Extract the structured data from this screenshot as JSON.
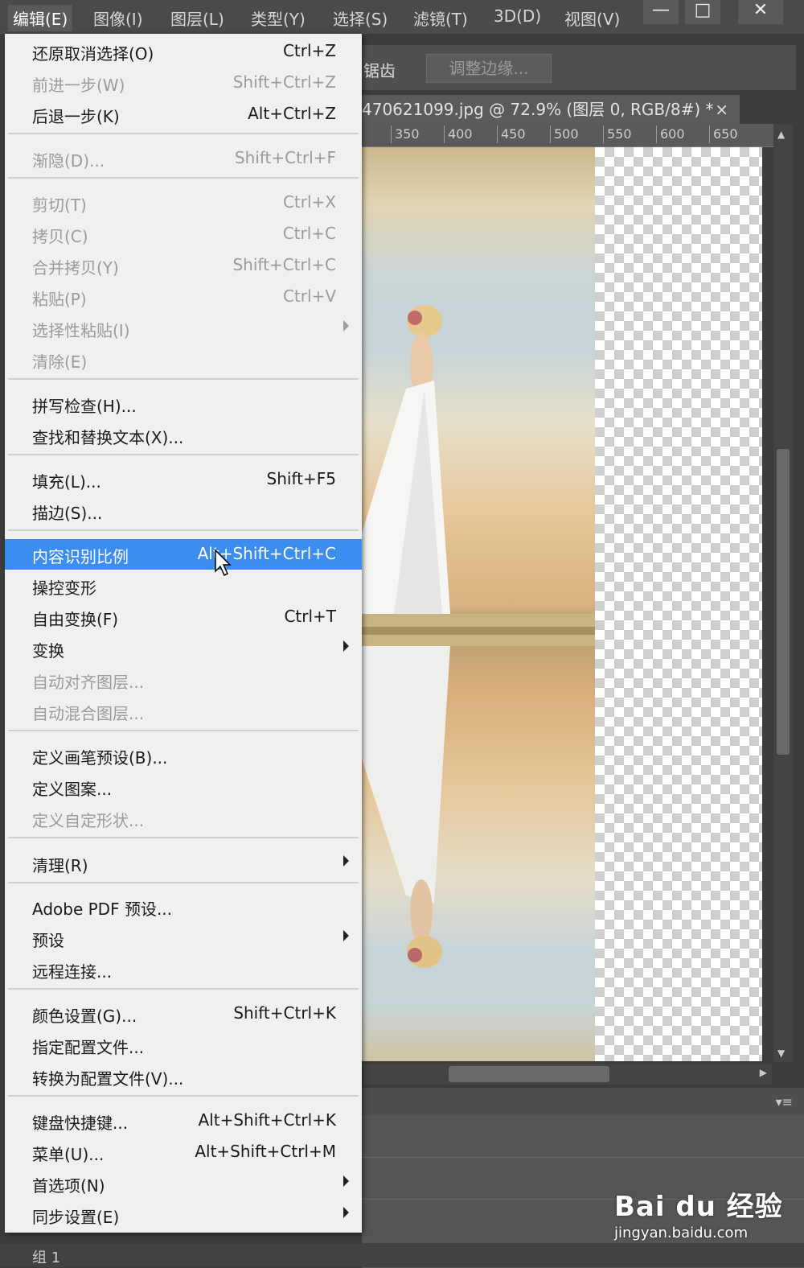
{
  "menubar": {
    "items": [
      "编辑(E)",
      "图像(I)",
      "图层(L)",
      "类型(Y)",
      "选择(S)",
      "滤镜(T)",
      "3D(D)",
      "视图(V)"
    ],
    "active_index": 0
  },
  "window_controls": {
    "minimize": "—",
    "maximize": "□",
    "close": "✕"
  },
  "options_bar": {
    "label": "锯齿",
    "refine_edge_button": "调整边缘..."
  },
  "document_tab": {
    "title": "470621099.jpg @ 72.9% (图层 0, RGB/8#) *",
    "close": "×"
  },
  "ruler": {
    "ticks": [
      "350",
      "400",
      "450",
      "500",
      "550",
      "600",
      "650"
    ]
  },
  "edit_menu": {
    "items": [
      {
        "label": "还原取消选择(O)",
        "shortcut": "Ctrl+Z",
        "enabled": true
      },
      {
        "label": "前进一步(W)",
        "shortcut": "Shift+Ctrl+Z",
        "enabled": false
      },
      {
        "label": "后退一步(K)",
        "shortcut": "Alt+Ctrl+Z",
        "enabled": true
      },
      {
        "label": "渐隐(D)...",
        "shortcut": "Shift+Ctrl+F",
        "enabled": false
      },
      {
        "label": "剪切(T)",
        "shortcut": "Ctrl+X",
        "enabled": false
      },
      {
        "label": "拷贝(C)",
        "shortcut": "Ctrl+C",
        "enabled": false
      },
      {
        "label": "合并拷贝(Y)",
        "shortcut": "Shift+Ctrl+C",
        "enabled": false
      },
      {
        "label": "粘贴(P)",
        "shortcut": "Ctrl+V",
        "enabled": false
      },
      {
        "label": "选择性粘贴(I)",
        "shortcut": "",
        "enabled": false,
        "submenu": true
      },
      {
        "label": "清除(E)",
        "shortcut": "",
        "enabled": false
      },
      {
        "label": "拼写检查(H)...",
        "shortcut": "",
        "enabled": true
      },
      {
        "label": "查找和替换文本(X)...",
        "shortcut": "",
        "enabled": true
      },
      {
        "label": "填充(L)...",
        "shortcut": "Shift+F5",
        "enabled": true
      },
      {
        "label": "描边(S)...",
        "shortcut": "",
        "enabled": true
      },
      {
        "label": "内容识别比例",
        "shortcut": "Alt+Shift+Ctrl+C",
        "enabled": true,
        "highlighted": true
      },
      {
        "label": "操控变形",
        "shortcut": "",
        "enabled": true
      },
      {
        "label": "自由变换(F)",
        "shortcut": "Ctrl+T",
        "enabled": true
      },
      {
        "label": "变换",
        "shortcut": "",
        "enabled": true,
        "submenu": true
      },
      {
        "label": "自动对齐图层...",
        "shortcut": "",
        "enabled": false
      },
      {
        "label": "自动混合图层...",
        "shortcut": "",
        "enabled": false
      },
      {
        "label": "定义画笔预设(B)...",
        "shortcut": "",
        "enabled": true
      },
      {
        "label": "定义图案...",
        "shortcut": "",
        "enabled": true
      },
      {
        "label": "定义自定形状...",
        "shortcut": "",
        "enabled": false
      },
      {
        "label": "清理(R)",
        "shortcut": "",
        "enabled": true,
        "submenu": true
      },
      {
        "label": "Adobe PDF 预设...",
        "shortcut": "",
        "enabled": true
      },
      {
        "label": "预设",
        "shortcut": "",
        "enabled": true,
        "submenu": true
      },
      {
        "label": "远程连接...",
        "shortcut": "",
        "enabled": true
      },
      {
        "label": "颜色设置(G)...",
        "shortcut": "Shift+Ctrl+K",
        "enabled": true
      },
      {
        "label": "指定配置文件...",
        "shortcut": "",
        "enabled": true
      },
      {
        "label": "转换为配置文件(V)...",
        "shortcut": "",
        "enabled": true
      },
      {
        "label": "键盘快捷键...",
        "shortcut": "Alt+Shift+Ctrl+K",
        "enabled": true
      },
      {
        "label": "菜单(U)...",
        "shortcut": "Alt+Shift+Ctrl+M",
        "enabled": true
      },
      {
        "label": "首选项(N)",
        "shortcut": "",
        "enabled": true,
        "submenu": true
      },
      {
        "label": "同步设置(E)",
        "shortcut": "",
        "enabled": true,
        "submenu": true
      }
    ]
  },
  "layers_panel": {
    "group_label": "组 1"
  },
  "watermark": {
    "logo": "Bai du 经验",
    "url": "jingyan.baidu.com"
  },
  "colors": {
    "highlight": "#3b8ef0",
    "menu_bg": "#f0f0f0",
    "app_bg": "#3c3c3c"
  }
}
